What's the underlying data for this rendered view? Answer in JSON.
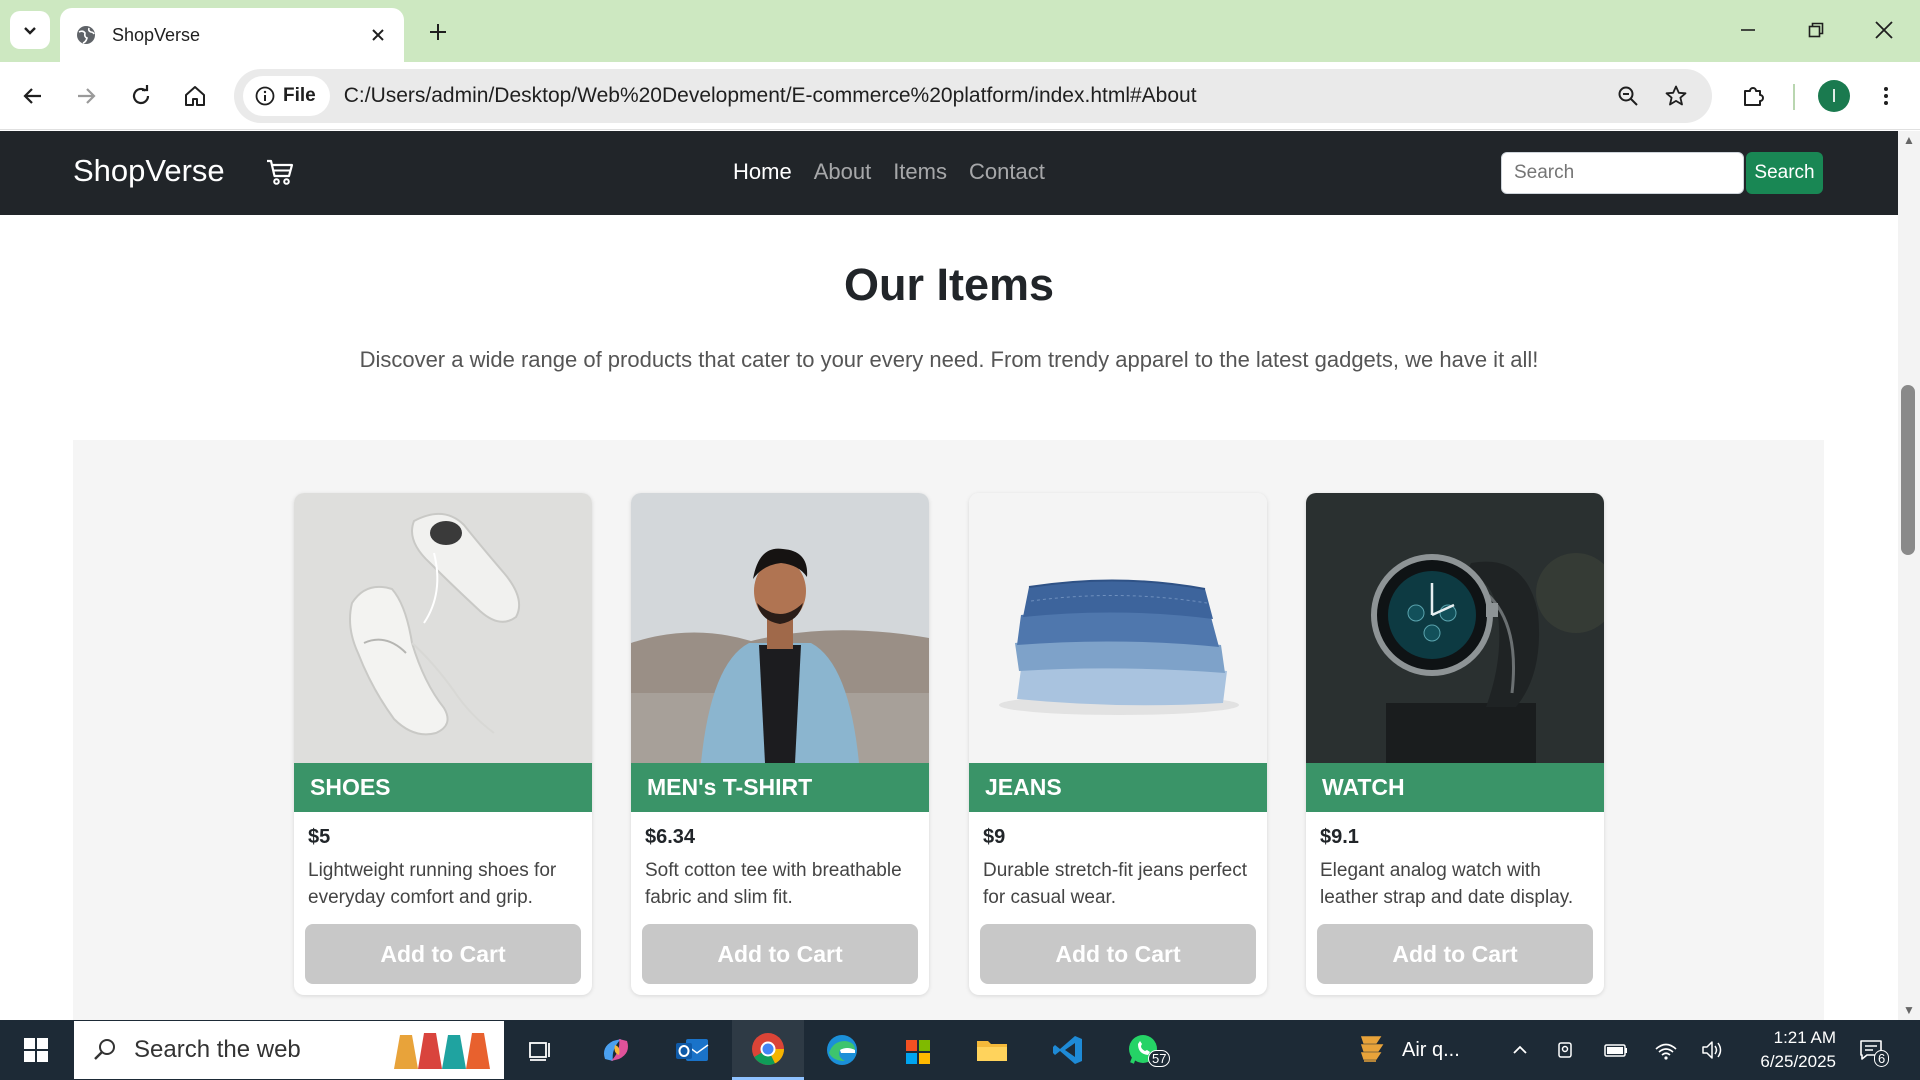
{
  "browser": {
    "tab_title": "ShopVerse",
    "url": "C:/Users/admin/Desktop/Web%20Development/E-commerce%20platform/index.html#About",
    "site_info_label": "File",
    "profile_initial": "I"
  },
  "navbar": {
    "brand": "ShopVerse",
    "links": [
      {
        "label": "Home",
        "active": true
      },
      {
        "label": "About"
      },
      {
        "label": "Items"
      },
      {
        "label": "Contact"
      }
    ],
    "search_placeholder": "Search",
    "search_button": "Search"
  },
  "section": {
    "title": "Our Items",
    "subtitle": "Discover a wide range of products that cater to your every need. From trendy apparel to the latest gadgets, we have it all!"
  },
  "items": [
    {
      "title": "SHOES",
      "price": "$5",
      "description": "Lightweight running shoes for everyday comfort and grip.",
      "button": "Add to Cart",
      "image": "white-sneakers-image"
    },
    {
      "title": "MEN's T-SHIRT",
      "price": "$6.34",
      "description": "Soft cotton tee with breathable fabric and slim fit.",
      "button": "Add to Cart",
      "image": "man-denim-jacket-image"
    },
    {
      "title": "JEANS",
      "price": "$9",
      "description": "Durable stretch-fit jeans perfect for casual wear.",
      "button": "Add to Cart",
      "image": "folded-jeans-image"
    },
    {
      "title": "WATCH",
      "price": "$9.1",
      "description": "Elegant analog watch with leather strap and date display.",
      "button": "Add to Cart",
      "image": "wrist-watch-image"
    }
  ],
  "taskbar": {
    "search_placeholder": "Search the web",
    "whatsapp_badge": "57",
    "weather_text": "Air q...",
    "time": "1:21 AM",
    "date": "6/25/2025",
    "notification_count": "6"
  },
  "colors": {
    "tabbar": "#cde8c1",
    "navbar": "#212529",
    "accent_green": "#198754",
    "card_title_green": "#3a9468",
    "add_to_cart_disabled": "#c8c8c8",
    "taskbar": "#1d2a36"
  }
}
